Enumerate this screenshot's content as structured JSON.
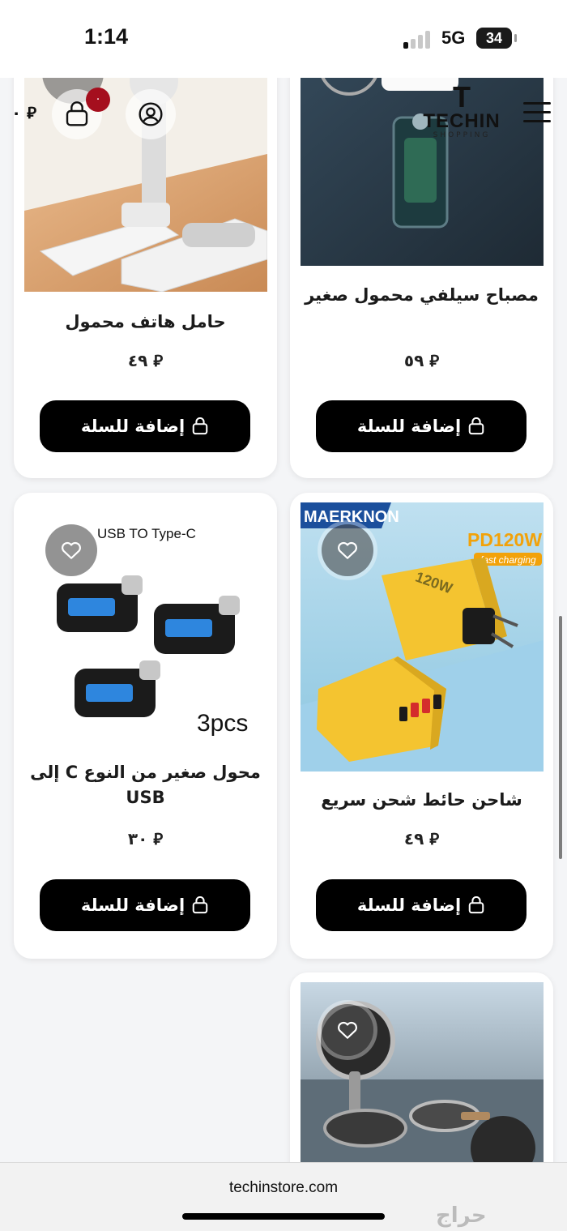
{
  "status_bar": {
    "time": "1:14",
    "network": "5G",
    "battery": "34"
  },
  "header": {
    "cart_total": "٠ ⃁",
    "cart_badge": "٠",
    "brand_letter": "T",
    "brand_name": "TECHIN",
    "brand_sub": "SHOPPING"
  },
  "products": [
    {
      "title": "حامل هاتف محمول",
      "price": "٤٩ ⃁",
      "button": "إضافة للسلة"
    },
    {
      "title": "مصباح سيلفي محمول صغير",
      "price": "٥٩ ⃁",
      "button": "إضافة للسلة"
    },
    {
      "title": "محول صغير من النوع C إلى USB",
      "price": "٣٠ ⃁",
      "button": "إضافة للسلة",
      "image_text": {
        "caption": "USB TO Type-C",
        "count": "3pcs"
      }
    },
    {
      "title": "شاحن حائط شحن سريع",
      "price": "٤٩ ⃁",
      "button": "إضافة للسلة",
      "image_text": {
        "brand": "MAERKNON",
        "power": "PD120W",
        "tag": "fast charging",
        "model": "120W"
      }
    }
  ],
  "browser": {
    "url": "techinstore.com",
    "watermark": "حراج"
  },
  "colors": {
    "accent": "#000000",
    "badge": "#a50f1e",
    "background": "#f4f5f7"
  },
  "icons": [
    "cart-icon",
    "user-icon",
    "menu-icon",
    "heart-icon",
    "bag-icon"
  ]
}
